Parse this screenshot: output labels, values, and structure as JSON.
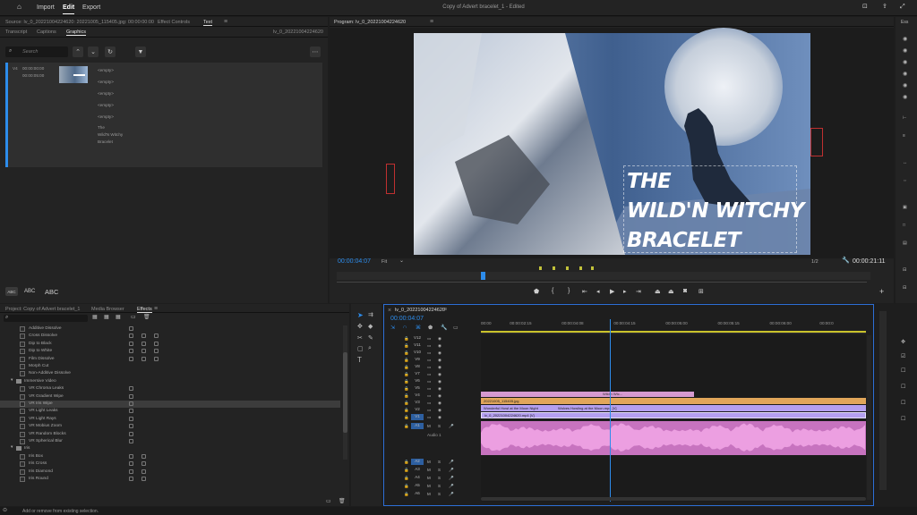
{
  "nav": {
    "import": "Import",
    "edit": "Edit",
    "export": "Export"
  },
  "app_title": "Copy of Advert bracelet_1 - Edited",
  "top_tabs": {
    "source": "Source: lv_0_20221004224620: 20221005_115405.jpg: 00:00:00:00",
    "effect_controls": "Effect Controls",
    "text": "Text"
  },
  "text_panel": {
    "tabs": [
      "Transcript",
      "Captions",
      "Graphics"
    ],
    "sequence_name": "lv_0_20221004224620",
    "search_placeholder": "Search",
    "layer_track": "V4",
    "layer_in": "00:00:00:00",
    "layer_out": "00:00:05:00",
    "layers": [
      "<empty>",
      "<empty>",
      "<empty>",
      "<empty>",
      "<empty>"
    ],
    "text_lines": [
      "The",
      "Wild'N Witchy",
      "Bracelet"
    ],
    "styles": [
      "ABC",
      "ABC",
      "ABC"
    ]
  },
  "program": {
    "title": "Program: lv_0_20221004224620",
    "title_line1": "THE",
    "title_line2": "WILD'N WITCHY",
    "title_line3": "BRACELET",
    "timecode": "00:00:04:07",
    "fit": "Fit",
    "ratio": "1/2",
    "duration": "00:00:21:11",
    "playhead_fraction": 0.27
  },
  "project": {
    "tabs": [
      "Project: Copy of Advert bracelet_1",
      "Media Browser",
      "Effects"
    ],
    "effects": [
      {
        "name": "Additive Dissolve",
        "indent": 2,
        "icons": 1
      },
      {
        "name": "Cross Dissolve",
        "indent": 2,
        "icons": 3
      },
      {
        "name": "Dip to Black",
        "indent": 2,
        "icons": 3
      },
      {
        "name": "Dip to White",
        "indent": 2,
        "icons": 3
      },
      {
        "name": "Film Dissolve",
        "indent": 2,
        "icons": 3
      },
      {
        "name": "Morph Cut",
        "indent": 2,
        "icons": 0
      },
      {
        "name": "Non-Additive Dissolve",
        "indent": 2,
        "icons": 0
      },
      {
        "name": "Immersive Video",
        "indent": 1,
        "icons": 0,
        "folder": true
      },
      {
        "name": "VR Chroma Leaks",
        "indent": 2,
        "icons": 1
      },
      {
        "name": "VR Gradient Wipe",
        "indent": 2,
        "icons": 1
      },
      {
        "name": "VR Iris Wipe",
        "indent": 2,
        "icons": 1,
        "selected": true
      },
      {
        "name": "VR Light Leaks",
        "indent": 2,
        "icons": 1
      },
      {
        "name": "VR Light Rays",
        "indent": 2,
        "icons": 1
      },
      {
        "name": "VR Mobius Zoom",
        "indent": 2,
        "icons": 1
      },
      {
        "name": "VR Random Blocks",
        "indent": 2,
        "icons": 1
      },
      {
        "name": "VR Spherical Blur",
        "indent": 2,
        "icons": 1
      },
      {
        "name": "Iris",
        "indent": 1,
        "icons": 0,
        "folder": true
      },
      {
        "name": "Iris Box",
        "indent": 2,
        "icons": 2
      },
      {
        "name": "Iris Cross",
        "indent": 2,
        "icons": 2
      },
      {
        "name": "Iris Diamond",
        "indent": 2,
        "icons": 2
      },
      {
        "name": "Iris Round",
        "indent": 2,
        "icons": 2
      }
    ]
  },
  "timeline": {
    "title": "lv_0_20221004224620",
    "timecode": "00:00:04:07",
    "ruler": [
      "00:00",
      "00:00:02:15",
      "00:00:04:08",
      "00:00:04:15",
      "00:00:05:00",
      "00:00:05:15",
      "00:00:06:00",
      "00:00:0"
    ],
    "video_tracks": [
      "V12",
      "V11",
      "V10",
      "V9",
      "V8",
      "V7",
      "V6",
      "V5",
      "V4",
      "V3",
      "V2",
      "V1"
    ],
    "audio_track": "A1",
    "audio_name": "Audio 1",
    "audio_tracks_extra": [
      "A2",
      "A3",
      "A4",
      "A5",
      "A6"
    ],
    "clips": {
      "v4": "Wild'n Wtc...",
      "v3": "20221005_115405.jpg",
      "v2a": "Wonderful Howl at the Moon Night",
      "v2b": "Wolves Howling at the Moon.mp4 [V]",
      "v1": "lv_0_20221004224620.mp4 [V]"
    },
    "playhead_fraction": 0.335
  },
  "status": "Add or remove from existing selection.",
  "colors": {
    "accent": "#2d8ceb",
    "clip_pink": "#d59ad0",
    "clip_orange": "#e1a65a",
    "clip_purple": "#b49ff0",
    "audio_pink": "#dc7fd0"
  }
}
